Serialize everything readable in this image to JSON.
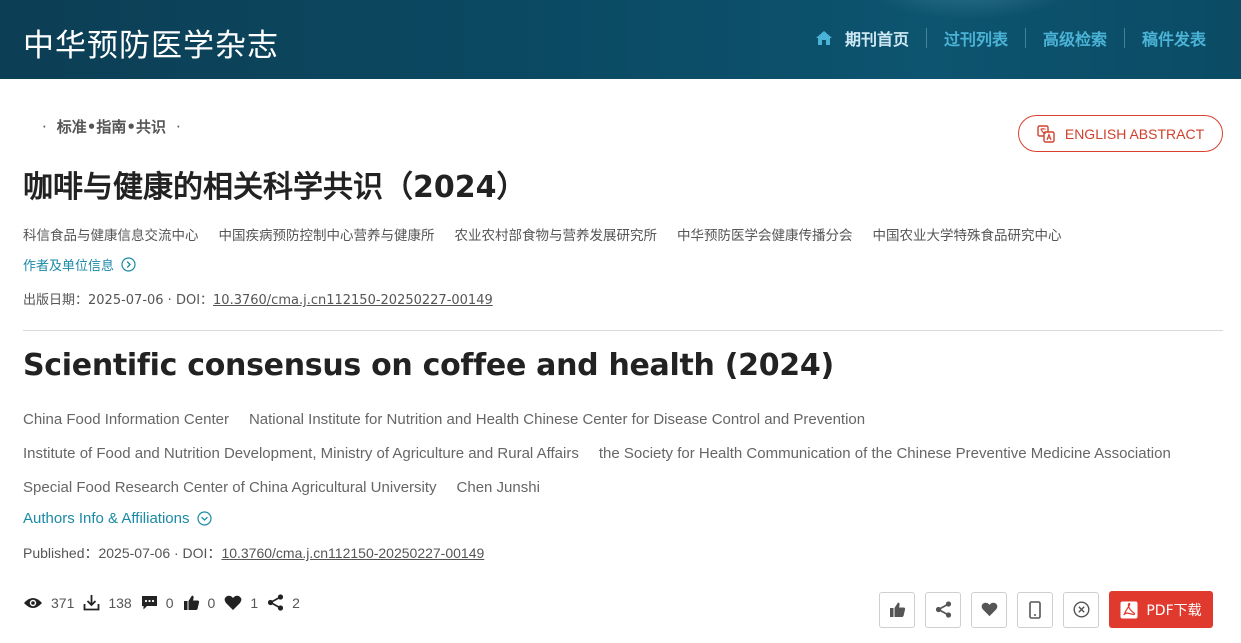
{
  "header": {
    "brand": "中华预防医学杂志",
    "nav": [
      {
        "label": "期刊首页",
        "active": true
      },
      {
        "label": "过刊列表"
      },
      {
        "label": "高级检索"
      },
      {
        "label": "稿件发表"
      }
    ]
  },
  "article": {
    "column": "标准•指南•共识",
    "column_dot": "·",
    "english_abstract_label": "ENGLISH ABSTRACT",
    "cn_title": "咖啡与健康的相关科学共识（2024）",
    "cn_affiliations": [
      "科信食品与健康信息交流中心",
      "中国疾病预防控制中心营养与健康所",
      "农业农村部食物与营养发展研究所",
      "中华预防医学会健康传播分会",
      "中国农业大学特殊食品研究中心"
    ],
    "cn_authors_toggle": "作者及单位信息",
    "cn_published_prefix": "出版日期：2025-07-06 · DOI：",
    "doi": "10.3760/cma.j.cn112150-20250227-00149",
    "en_title": "Scientific consensus on coffee and health (2024)",
    "en_affiliations_rows": [
      [
        "China Food Information Center",
        "National Institute for Nutrition and Health Chinese Center for Disease Control and Prevention"
      ],
      [
        "Institute of Food and Nutrition Development, Ministry of Agriculture and Rural Affairs",
        "the Society for Health Communication of the Chinese Preventive Medicine Association"
      ],
      [
        "Special Food Research Center of China Agricultural University",
        "Chen Junshi"
      ]
    ],
    "en_authors_toggle": "Authors Info & Affiliations",
    "en_published_prefix": "Published：2025-07-06 · DOI："
  },
  "stats": [
    {
      "icon": "eye-icon",
      "value": "371"
    },
    {
      "icon": "download-icon",
      "value": "138"
    },
    {
      "icon": "comment-icon",
      "value": "0"
    },
    {
      "icon": "thumbs-up-icon",
      "value": "0"
    },
    {
      "icon": "heart-icon",
      "value": "1"
    },
    {
      "icon": "share-icon",
      "value": "2"
    }
  ],
  "actions": {
    "pdf_label": "PDF下载"
  },
  "colors": {
    "header_bg": "#0b4a63",
    "nav_link": "#4bb3d6",
    "accent_link": "#1a8aa6",
    "pdf_red": "#e03a2f"
  }
}
